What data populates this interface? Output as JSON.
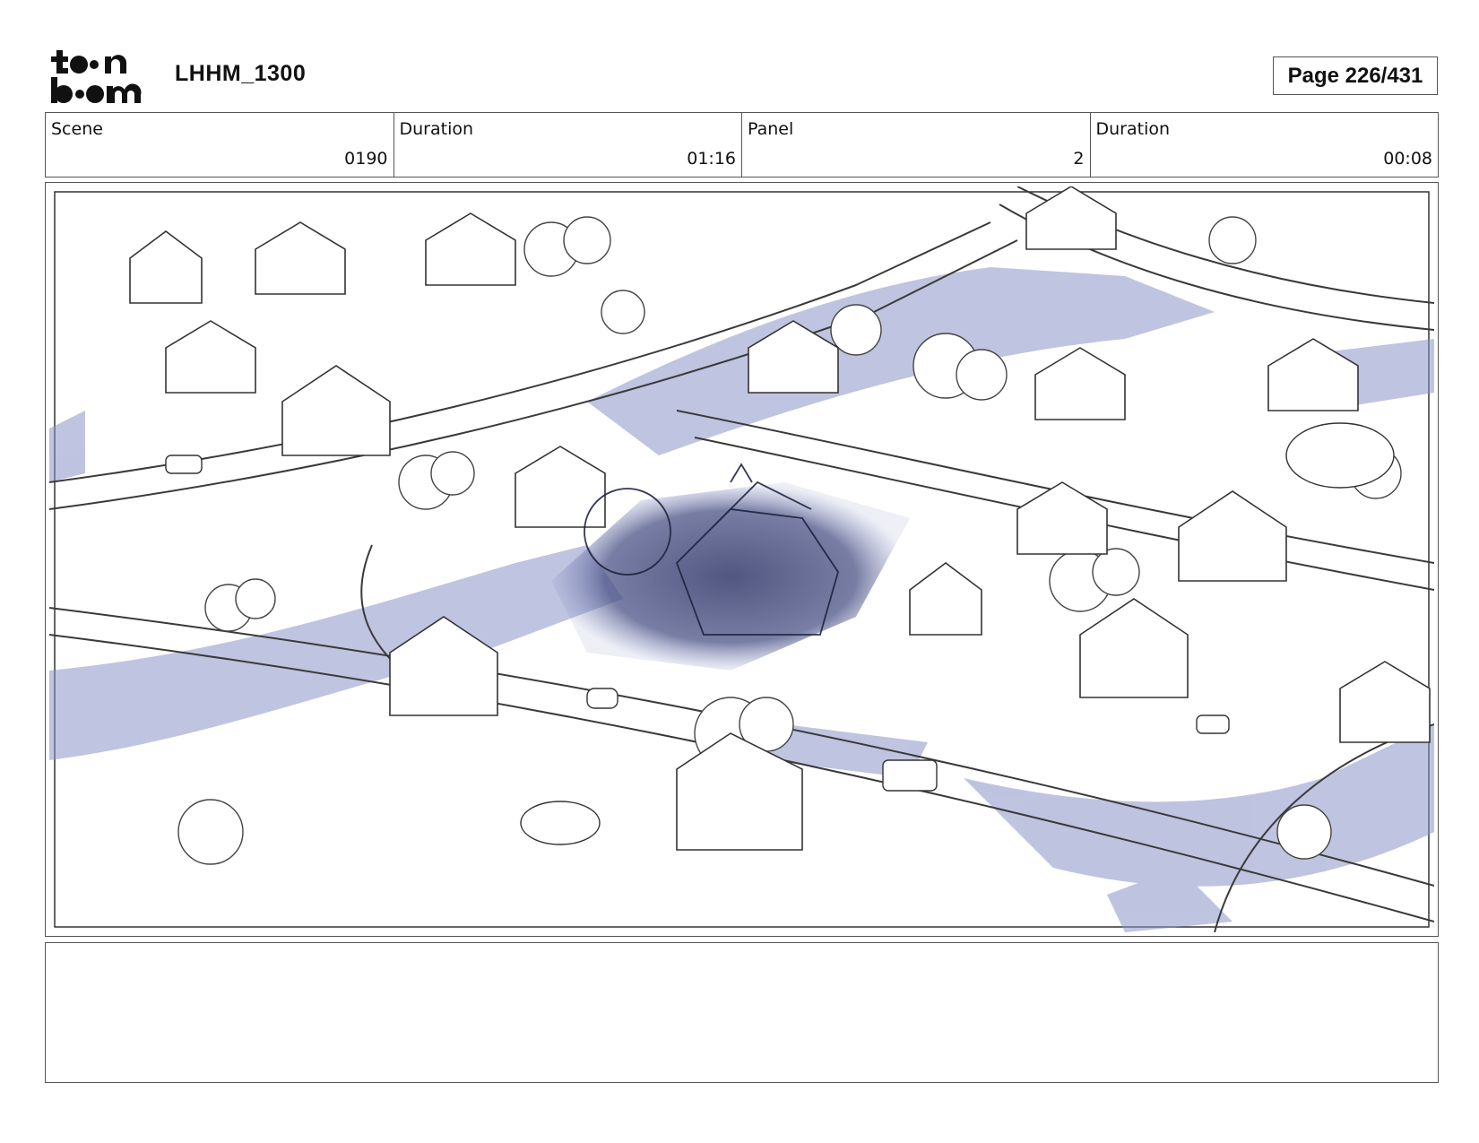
{
  "header": {
    "logo_text": "toonboom",
    "project_title": "LHHM_1300",
    "page_label": "Page 226/431"
  },
  "info": {
    "scene_label": "Scene",
    "scene_value": "0190",
    "scene_duration_label": "Duration",
    "scene_duration_value": "01:16",
    "panel_label": "Panel",
    "panel_value": "2",
    "panel_duration_label": "Duration",
    "panel_duration_value": "00:08"
  },
  "notes": {
    "text": ""
  },
  "colors": {
    "border": "#555555",
    "shadow_tint": "#8a93c7",
    "shadow_dark": "#3d4472",
    "sketch_line": "#3a3a3a"
  }
}
